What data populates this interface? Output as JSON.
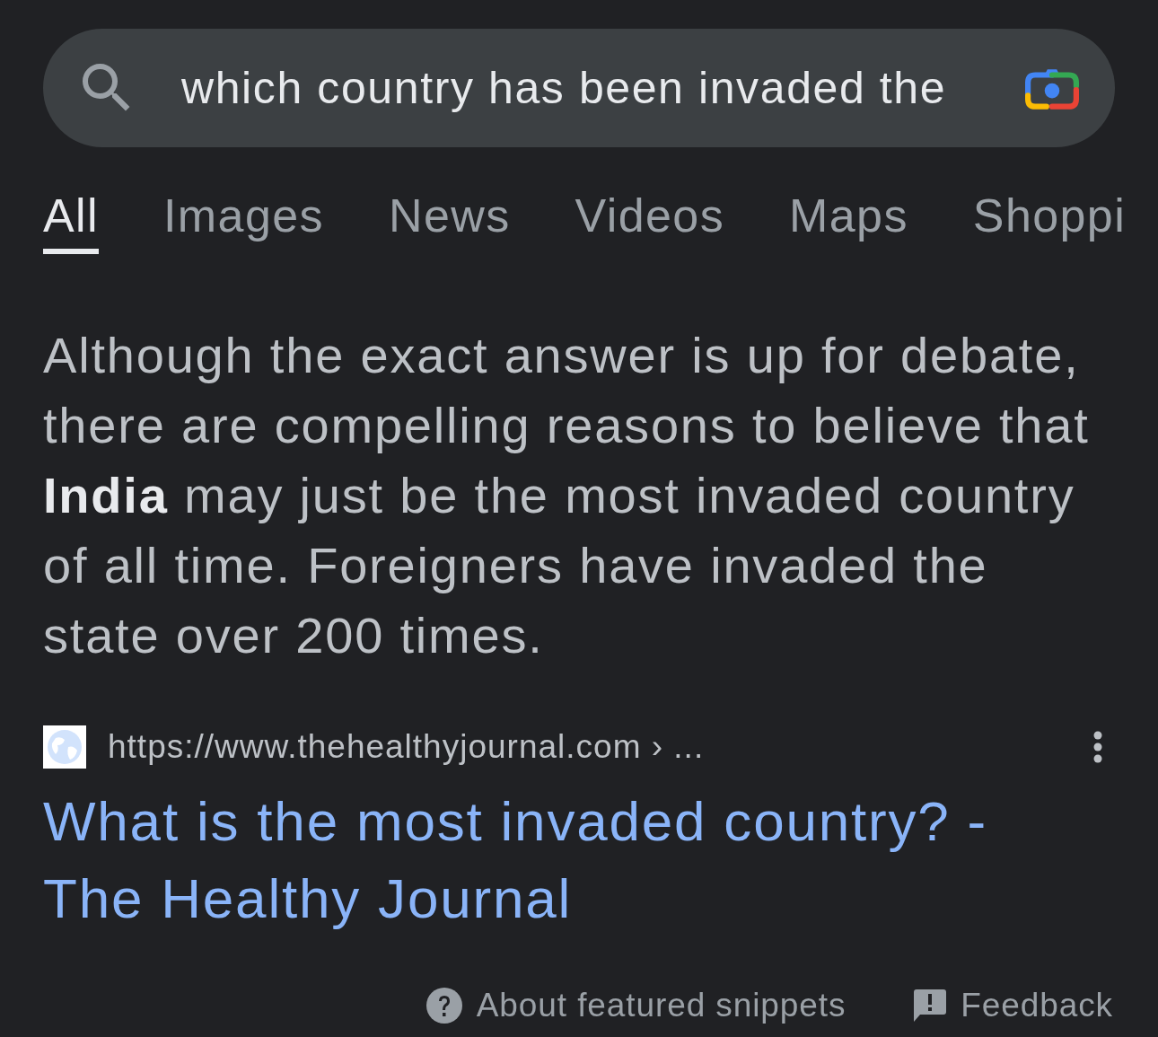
{
  "search": {
    "value": "which country has been invaded the"
  },
  "tabs": [
    {
      "label": "All",
      "selected": true
    },
    {
      "label": "Images",
      "selected": false
    },
    {
      "label": "News",
      "selected": false
    },
    {
      "label": "Videos",
      "selected": false
    },
    {
      "label": "Maps",
      "selected": false
    },
    {
      "label": "Shoppi",
      "selected": false
    }
  ],
  "snippet": {
    "text": "Although the exact answer is up for debate, there are compelling reasons to believe that **India** may just be the most invaded country of all time. Foreigners have invaded the state over 200 times."
  },
  "result": {
    "url": "https://www.thehealthyjournal.com › ...",
    "title": "What is the most invaded country? - The Healthy Journal"
  },
  "footer": [
    {
      "kind": "about",
      "label": "About featured snippets"
    },
    {
      "kind": "feedback",
      "label": "Feedback"
    }
  ]
}
